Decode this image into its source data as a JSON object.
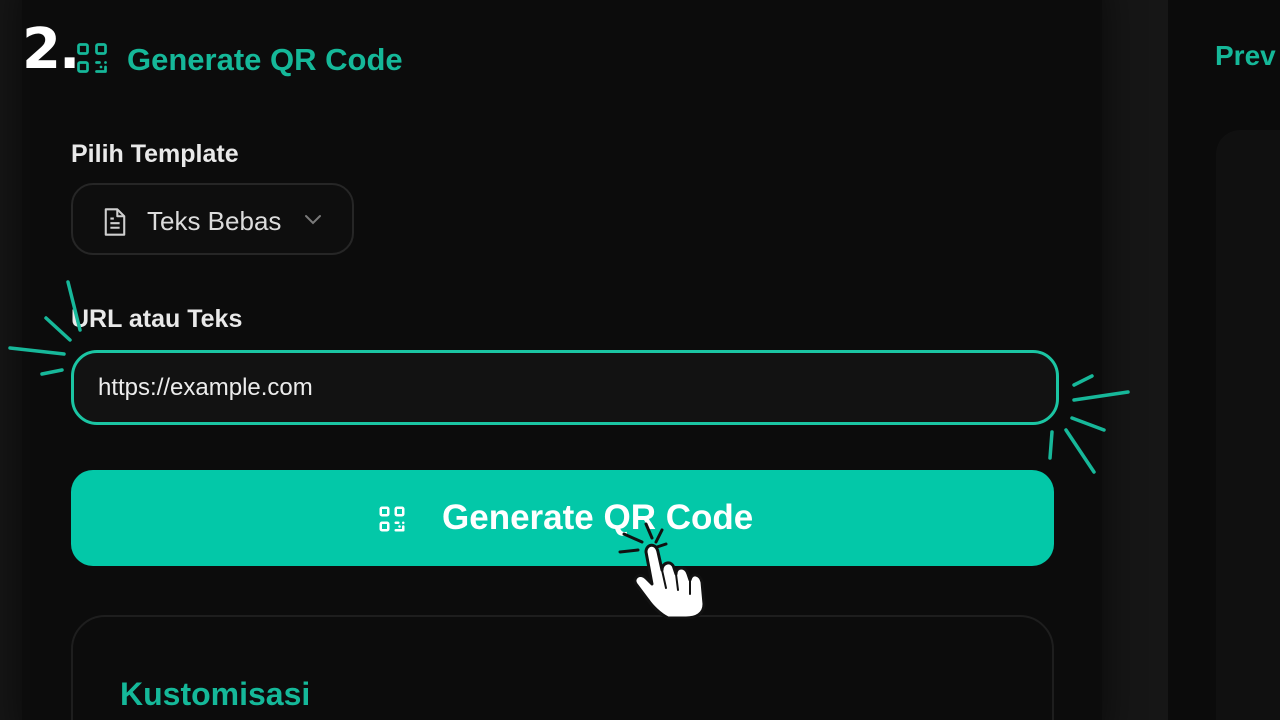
{
  "step": {
    "number": "2."
  },
  "header": {
    "title": "Generate QR Code",
    "icon": "qr-code-icon"
  },
  "preview": {
    "title": "Prev"
  },
  "form": {
    "template_label": "Pilih Template",
    "template_value": "Teks Bebas",
    "url_label": "URL atau Teks",
    "url_value": "https://example.com"
  },
  "actions": {
    "generate_label": "Generate QR Code"
  },
  "customization": {
    "title": "Kustomisasi"
  },
  "colors": {
    "accent": "#15b899",
    "button": "#03c8a8",
    "background": "#0c0c0c"
  }
}
